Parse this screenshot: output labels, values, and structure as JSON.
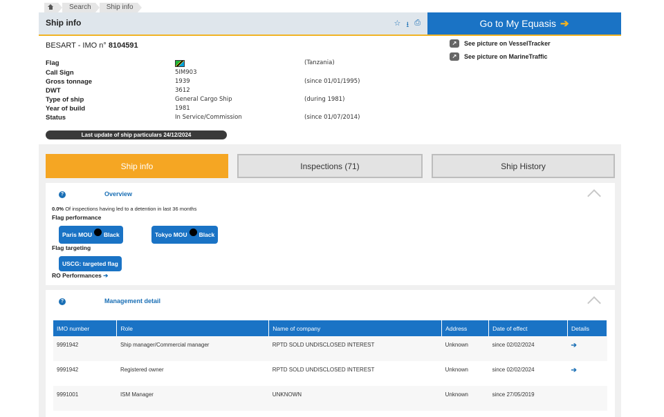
{
  "breadcrumb": {
    "home_icon": "home-icon",
    "items": [
      "Search",
      "Ship info"
    ]
  },
  "header": {
    "title": "Ship info",
    "icons": [
      "star-icon",
      "download-icon",
      "print-icon"
    ]
  },
  "equasis_button": {
    "label": "Go to My Equasis",
    "arrow": "➔"
  },
  "ship": {
    "name": "BESART",
    "imo_label": "IMO n°",
    "imo": "8104591",
    "separator": "-"
  },
  "picture_links": [
    {
      "label": "See picture on VesselTracker",
      "icon": "external-link-icon"
    },
    {
      "label": "See picture on MarineTraffic",
      "icon": "external-link-icon"
    }
  ],
  "particulars": [
    {
      "label": "Flag",
      "value": "",
      "note": "(Tanzania)",
      "flag": true
    },
    {
      "label": "Call Sign",
      "value": "5IM903",
      "note": ""
    },
    {
      "label": "Gross tonnage",
      "value": "1939",
      "note": "(since 01/01/1995)"
    },
    {
      "label": "DWT",
      "value": "3612",
      "note": ""
    },
    {
      "label": "Type of ship",
      "value": "General Cargo Ship",
      "note": "(during 1981)"
    },
    {
      "label": "Year of build",
      "value": "1981",
      "note": ""
    },
    {
      "label": "Status",
      "value": "In Service/Commission",
      "note": "(since 01/07/2014)"
    }
  ],
  "last_update": "Last update of ship particulars 24/12/2024",
  "tabs": [
    {
      "label": "Ship info",
      "active": true
    },
    {
      "label": "Inspections (71)",
      "active": false
    },
    {
      "label": "Ship History",
      "active": false
    }
  ],
  "overview": {
    "title": "Overview",
    "help": "?",
    "detention_pct": "0.0%",
    "detention_text": "Of inspections having led to a detention in last 36 months",
    "flag_performance_label": "Flag performance",
    "mou_badges": [
      {
        "org": "Paris MOU",
        "list": "Black"
      },
      {
        "org": "Tokyo MOU",
        "list": "Black"
      }
    ],
    "flag_targeting_label": "Flag targeting",
    "uscg_badge": "USCG: targeted flag",
    "ro_performances": "RO Performances",
    "ro_arrow": "➔"
  },
  "management": {
    "title": "Management detail",
    "help": "?",
    "columns": [
      "IMO number",
      "Role",
      "Name of company",
      "Address",
      "Date of effect",
      "Details"
    ],
    "rows": [
      {
        "imo": "9991942",
        "role": "Ship manager/Commercial manager",
        "company": "RPTD SOLD UNDISCLOSED INTEREST",
        "address": "Unknown",
        "date": "since 02/02/2024",
        "details": "➔"
      },
      {
        "imo": "9991942",
        "role": "Registered owner",
        "company": "RPTD SOLD UNDISCLOSED INTEREST",
        "address": "Unknown",
        "date": "since 02/02/2024",
        "details": "➔"
      },
      {
        "imo": "9991001",
        "role": "ISM Manager",
        "company": "UNKNOWN",
        "address": "Unknown",
        "date": "since 27/05/2019",
        "details": ""
      }
    ]
  },
  "colors": {
    "accent_blue": "#1a73c5",
    "accent_orange": "#f5a623",
    "header_bg": "#dfe6ec"
  }
}
